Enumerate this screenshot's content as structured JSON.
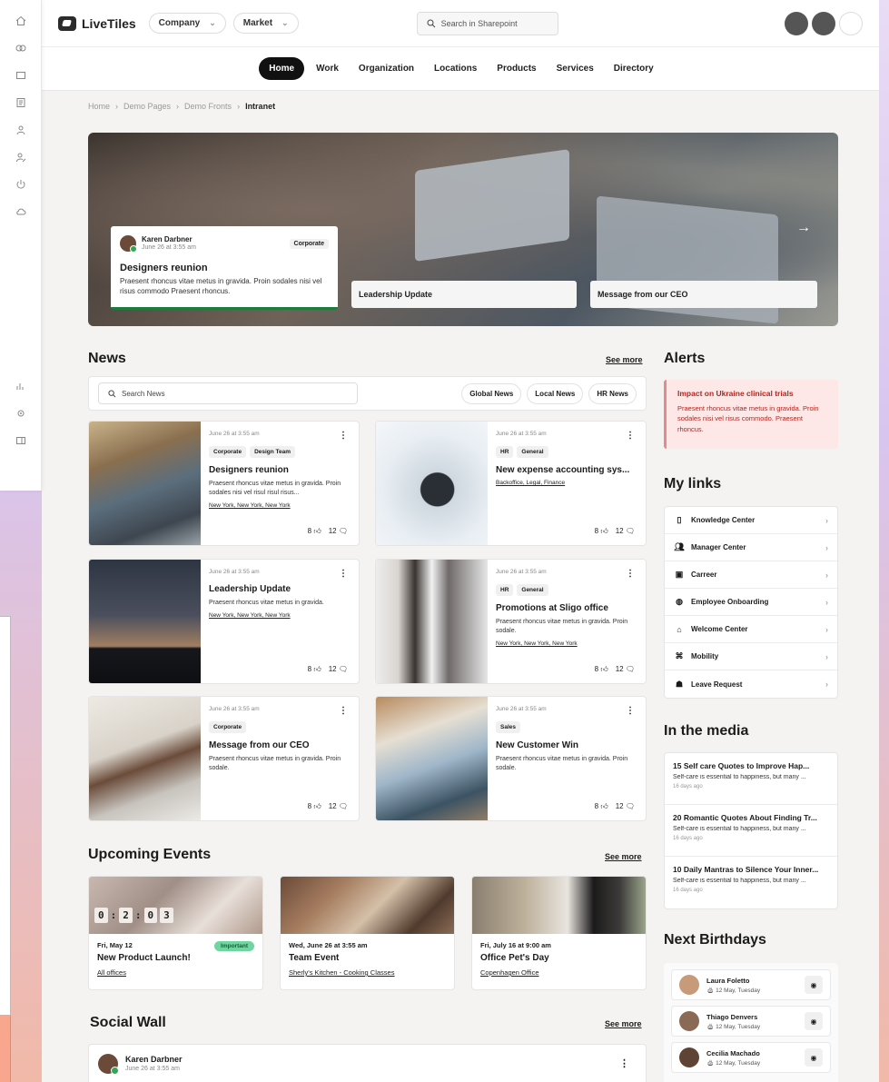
{
  "app": {
    "name": "LiveTiles"
  },
  "topbar": {
    "company_label": "Company",
    "market_label": "Market",
    "search_placeholder": "Search in Sharepoint"
  },
  "nav": {
    "items": [
      "Home",
      "Work",
      "Organization",
      "Locations",
      "Products",
      "Services",
      "Directory"
    ],
    "active": "Home"
  },
  "breadcrumb": [
    "Home",
    "Demo Pages",
    "Demo Fronts",
    "Intranet"
  ],
  "hero": {
    "card": {
      "author": "Karen Darbner",
      "date": "June 26 at 3:55 am",
      "tag": "Corporate",
      "title": "Designers reunion",
      "body": "Praesent rhoncus vitae metus in gravida. Proin sodales nisi vel risus commodo Praesent rhoncus."
    },
    "mini1": "Leadership Update",
    "mini2": "Message from our CEO"
  },
  "news": {
    "title": "News",
    "see_more": "See more",
    "search_placeholder": "Search News",
    "filters": [
      "Global News",
      "Local News",
      "HR News"
    ],
    "cards": [
      {
        "date": "June 26 at 3:55 am",
        "tags": [
          "Corporate",
          "Design Team"
        ],
        "title": "Designers reunion",
        "body": "Praesent rhoncus vitae metus in gravida. Proin sodales nisi vel risul risul risus...",
        "links": "New York, New York, New York",
        "likes": "8",
        "comments": "12"
      },
      {
        "date": "June 26 at 3:55 am",
        "tags": [
          "HR",
          "General"
        ],
        "title": "New expense accounting sys...",
        "body": "",
        "links": "Backoffice, Legal, Finance",
        "likes": "8",
        "comments": "12"
      },
      {
        "date": "June 26 at 3:55 am",
        "tags": [],
        "title": "Leadership Update",
        "body": "Praesent rhoncus vitae metus in gravida.",
        "links": "New York, New York, New York",
        "likes": "8",
        "comments": "12"
      },
      {
        "date": "June 26 at 3:55 am",
        "tags": [
          "HR",
          "General"
        ],
        "title": "Promotions at Sligo office",
        "body": "Praesent rhoncus vitae metus in gravida. Proin sodale.",
        "links": "New York, New York, New York",
        "likes": "8",
        "comments": "12"
      },
      {
        "date": "June 26 at 3:55 am",
        "tags": [
          "Corporate"
        ],
        "title": "Message from our CEO",
        "body": "Praesent rhoncus vitae metus in gravida. Proin sodale.",
        "links": "",
        "likes": "8",
        "comments": "12"
      },
      {
        "date": "June 26 at 3:55 am",
        "tags": [
          "Sales"
        ],
        "title": "New Customer Win",
        "body": "Praesent rhoncus vitae metus in gravida. Proin sodale.",
        "links": "",
        "likes": "8",
        "comments": "12"
      }
    ]
  },
  "events": {
    "title": "Upcoming Events",
    "see_more": "See more",
    "timer": [
      "0",
      "2",
      "0",
      "3"
    ],
    "items": [
      {
        "date": "Fri, May 12",
        "title": "New Product Launch!",
        "location": "All offices",
        "badge": "Important"
      },
      {
        "date": "Wed, June 26 at 3:55 am",
        "title": "Team Event",
        "location": "Sherly's Kitchen - Cooking Classes",
        "badge": ""
      },
      {
        "date": "Fri, July 16 at 9:00 am",
        "title": "Office Pet's Day",
        "location": "Copenhagen Office",
        "badge": ""
      }
    ]
  },
  "social": {
    "title": "Social Wall",
    "see_more": "See more",
    "author": "Karen Darbner",
    "date": "June 26 at 3:55 am"
  },
  "alerts": {
    "title": "Alerts",
    "item_title": "Impact on Ukraine clinical trials",
    "item_body": "Praesent rhoncus vitae metus in gravida. Proin sodales nisi vel risus commodo. Praesent rhoncus."
  },
  "my_links": {
    "title": "My links",
    "items": [
      "Knowledge Center",
      "Manager Center",
      "Carreer",
      "Employee Onboarding",
      "Welcome Center",
      "Mobility",
      "Leave Request"
    ]
  },
  "media": {
    "title": "In the media",
    "items": [
      {
        "title": "15 Self care Quotes to Improve Hap...",
        "desc": "Self-care is essential to happiness, but many ...",
        "ago": "16 days ago"
      },
      {
        "title": "20 Romantic Quotes About Finding Tr...",
        "desc": "Self-care is essential to happiness, but many ...",
        "ago": "16 days ago"
      },
      {
        "title": "10 Daily Mantras to Silence Your Inner...",
        "desc": "Self-care is essential to happiness, but many ...",
        "ago": "16 days ago"
      }
    ]
  },
  "birthdays": {
    "title": "Next Birthdays",
    "items": [
      {
        "name": "Laura Foletto",
        "date": "12 May, Tuesday"
      },
      {
        "name": "Thiago Denvers",
        "date": "12 May, Tuesday"
      },
      {
        "name": "Cecilia Machado",
        "date": "12 May, Tuesday"
      }
    ]
  }
}
